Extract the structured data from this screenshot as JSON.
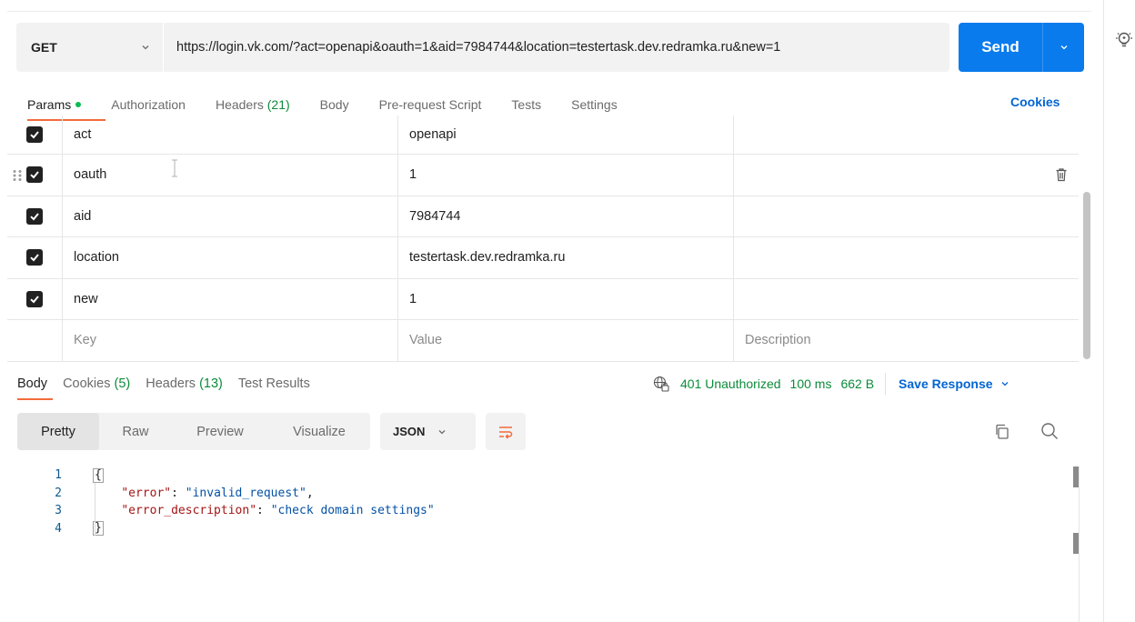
{
  "request": {
    "method": "GET",
    "url": "https://login.vk.com/?act=openapi&oauth=1&aid=7984744&location=testertask.dev.redramka.ru&new=1",
    "send_label": "Send"
  },
  "request_tabs": {
    "params": "Params",
    "authorization": "Authorization",
    "headers_label": "Headers",
    "headers_count": "(21)",
    "body": "Body",
    "pre_request": "Pre-request Script",
    "tests": "Tests",
    "settings": "Settings",
    "cookies": "Cookies"
  },
  "params": {
    "rows": [
      {
        "key": "act",
        "value": "openapi"
      },
      {
        "key": "oauth",
        "value": "1"
      },
      {
        "key": "aid",
        "value": "7984744"
      },
      {
        "key": "location",
        "value": "testertask.dev.redramka.ru"
      },
      {
        "key": "new",
        "value": "1"
      }
    ],
    "placeholders": {
      "key": "Key",
      "value": "Value",
      "description": "Description"
    }
  },
  "response_tabs": {
    "body": "Body",
    "cookies_label": "Cookies",
    "cookies_count": "(5)",
    "headers_label": "Headers",
    "headers_count": "(13)",
    "test_results": "Test Results"
  },
  "response_meta": {
    "status": "401 Unauthorized",
    "time": "100 ms",
    "size": "662 B",
    "save_response": "Save Response"
  },
  "view_modes": {
    "pretty": "Pretty",
    "raw": "Raw",
    "preview": "Preview",
    "visualize": "Visualize",
    "format": "JSON"
  },
  "code": {
    "line_numbers": [
      "1",
      "2",
      "3",
      "4"
    ],
    "open_brace": "{",
    "close_brace": "}",
    "key1": "\"error\"",
    "val1": "\"invalid_request\"",
    "key2": "\"error_description\"",
    "val2": "\"check domain settings\""
  },
  "colors": {
    "accent_blue": "#097bed",
    "link_blue": "#0265d2",
    "active_tab": "#f26b3a",
    "status_green": "#0c8b3a"
  },
  "icons": [
    "lightbulb-icon",
    "chevron-down-icon",
    "checkbox-checked-icon",
    "drag-handle-icon",
    "trash-icon",
    "globe-lock-icon",
    "wrap-lines-icon",
    "copy-icon",
    "search-icon"
  ]
}
